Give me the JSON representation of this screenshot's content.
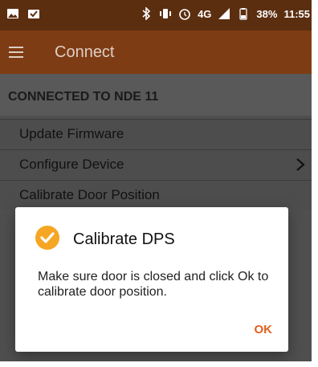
{
  "status_bar": {
    "icons_left": [
      "image-icon",
      "check-mail-icon"
    ],
    "icons_right": [
      "bluetooth-icon",
      "vibrate-icon",
      "alarm-icon",
      "lte-signal-icon",
      "battery-icon"
    ],
    "network": "4G",
    "battery": "38%",
    "time": "11:55"
  },
  "app_bar": {
    "title": "Connect"
  },
  "section": {
    "header": "CONNECTED TO NDE 11"
  },
  "list": {
    "items": [
      {
        "label": "Update Firmware"
      },
      {
        "label": "Configure Device"
      },
      {
        "label": "Calibrate Door Position"
      }
    ]
  },
  "dialog": {
    "title": "Calibrate DPS",
    "message": "Make sure door is closed and click Ok to calibrate door position.",
    "ok_label": "OK",
    "icon": "check-circle-icon"
  },
  "colors": {
    "status_bar": "#5b2e10",
    "app_bar": "#7e3c14",
    "dim_background": "#4f4f4f",
    "accent": "#e45f1c",
    "check_icon": "#f5a623"
  }
}
